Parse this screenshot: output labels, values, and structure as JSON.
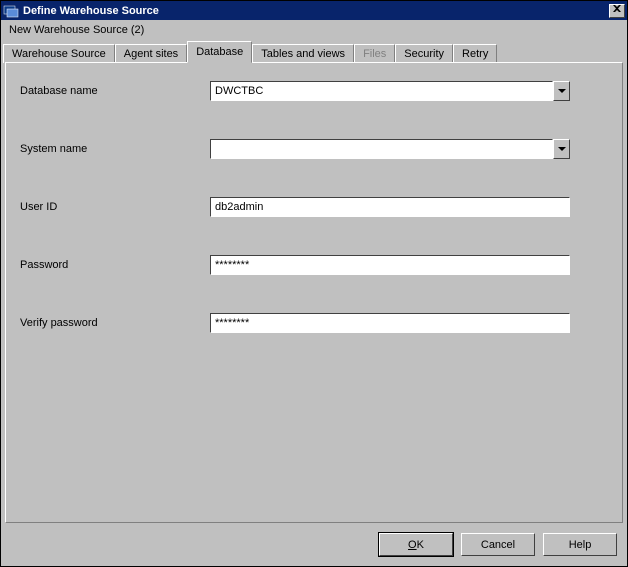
{
  "window": {
    "title": "Define Warehouse Source",
    "subtitle": "New Warehouse Source (2)"
  },
  "tabs": [
    {
      "label": "Warehouse Source",
      "active": false,
      "disabled": false
    },
    {
      "label": "Agent sites",
      "active": false,
      "disabled": false
    },
    {
      "label": "Database",
      "active": true,
      "disabled": false
    },
    {
      "label": "Tables and views",
      "active": false,
      "disabled": false
    },
    {
      "label": "Files",
      "active": false,
      "disabled": true
    },
    {
      "label": "Security",
      "active": false,
      "disabled": false
    },
    {
      "label": "Retry",
      "active": false,
      "disabled": false
    }
  ],
  "fields": {
    "database_name": {
      "label": "Database name",
      "value": "DWCTBC",
      "combo": true
    },
    "system_name": {
      "label": "System name",
      "value": "",
      "combo": true
    },
    "user_id": {
      "label": "User ID",
      "value": "db2admin",
      "combo": false
    },
    "password": {
      "label": "Password",
      "value": "********",
      "combo": false
    },
    "verify_password": {
      "label": "Verify password",
      "value": "********",
      "combo": false
    }
  },
  "buttons": {
    "ok": "OK",
    "cancel": "Cancel",
    "help": "Help"
  }
}
